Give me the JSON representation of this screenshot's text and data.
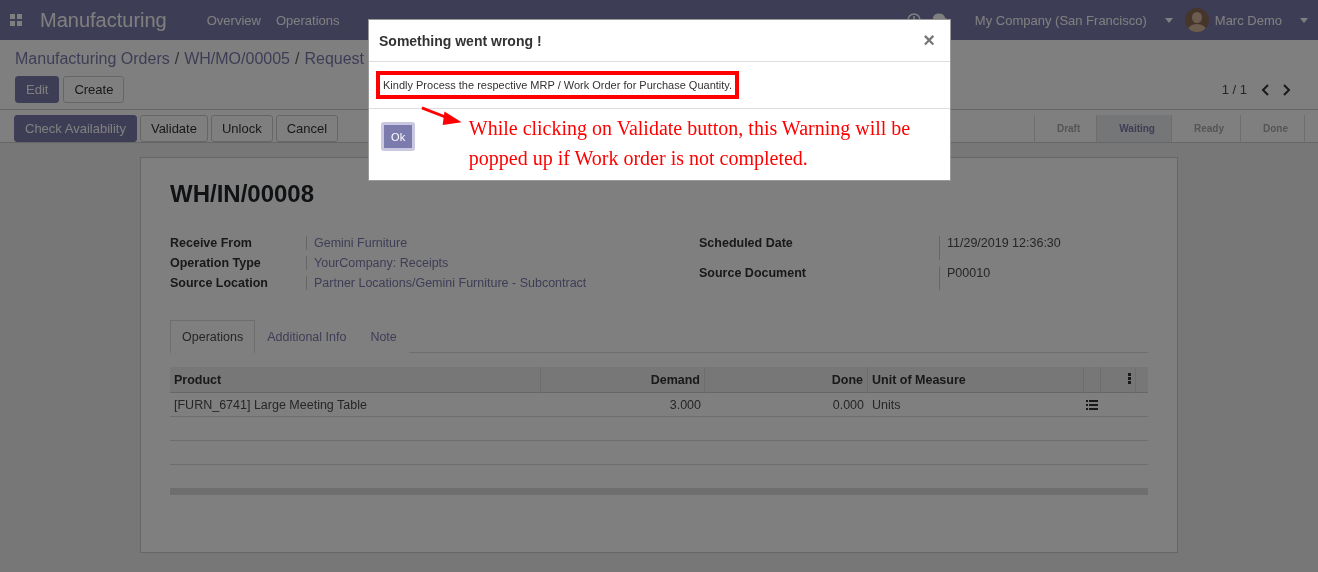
{
  "navbar": {
    "app_name": "Manufacturing",
    "menu": [
      "Overview",
      "Operations"
    ],
    "company": "My Company (San Francisco)",
    "user": "Marc Demo"
  },
  "breadcrumb": [
    "Manufacturing Orders",
    "WH/MO/00005",
    "Request"
  ],
  "breadcrumb_separator": "/",
  "actions": [
    "Edit",
    "Create"
  ],
  "pager": "1 / 1",
  "header_buttons": [
    {
      "label": "Check Availability",
      "primary": true
    },
    {
      "label": "Validate",
      "primary": false
    },
    {
      "label": "Unlock",
      "primary": false
    },
    {
      "label": "Cancel",
      "primary": false
    }
  ],
  "status_steps": [
    {
      "label": "Draft",
      "selected": false
    },
    {
      "label": "Waiting",
      "selected": true
    },
    {
      "label": "Ready",
      "selected": false
    },
    {
      "label": "Done",
      "selected": false
    }
  ],
  "record": {
    "title": "WH/IN/00008",
    "left_fields": [
      {
        "label": "Receive From",
        "value": "Gemini Furniture",
        "link": true
      },
      {
        "label": "Operation Type",
        "value": "YourCompany: Receipts",
        "link": true
      },
      {
        "label": "Source Location",
        "value": "Partner Locations/Gemini Furniture - Subcontract",
        "link": true
      }
    ],
    "right_fields": [
      {
        "label": "Scheduled Date",
        "value": "11/29/2019 12:36:30",
        "link": false
      },
      {
        "label": "Source Document",
        "value": "P00010",
        "link": false
      }
    ],
    "tabs": [
      {
        "label": "Operations",
        "selected": true
      },
      {
        "label": "Additional Info",
        "selected": false
      },
      {
        "label": "Note",
        "selected": false
      }
    ],
    "table": {
      "columns": [
        "Product",
        "Demand",
        "Done",
        "Unit of Measure"
      ],
      "rows": [
        {
          "product": "[FURN_6741] Large Meeting Table",
          "demand": "3.000",
          "done": "0.000",
          "uom": "Units"
        }
      ]
    }
  },
  "dialog": {
    "title": "Something went wrong !",
    "close": "×",
    "message": "Kindly Process the respective MRP / Work Order for Purchase Quantity.",
    "button": "Ok",
    "annotation": "While clicking on Validate button, this Warning will be popped up if Work order is not completed."
  }
}
